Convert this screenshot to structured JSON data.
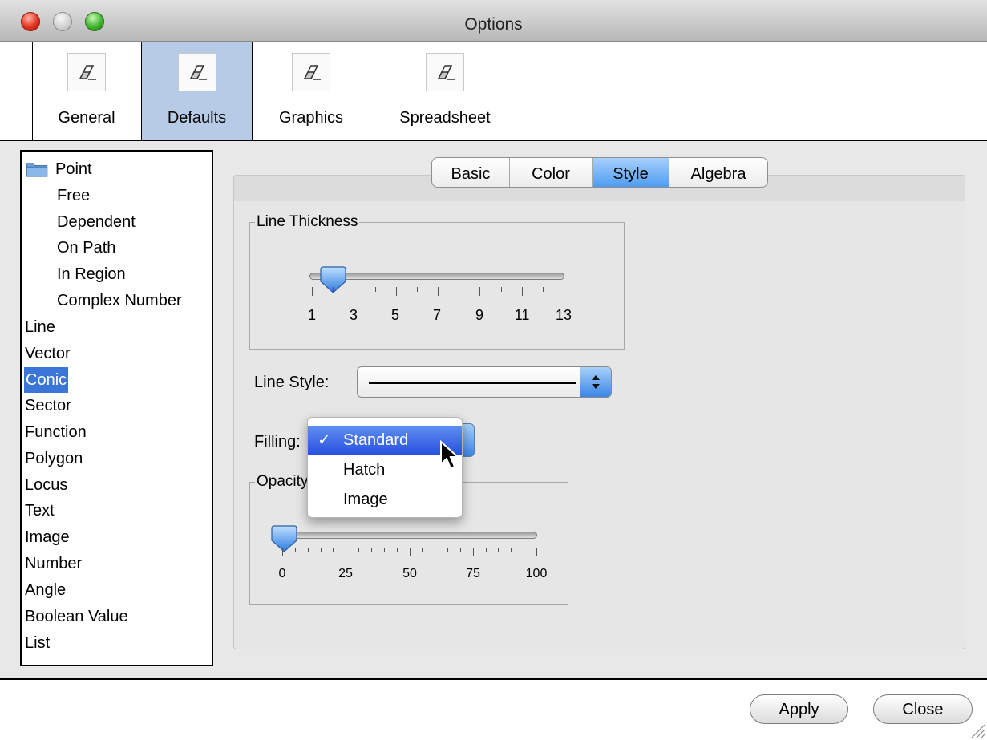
{
  "window": {
    "title": "Options"
  },
  "toolbar": {
    "buttons": [
      {
        "label": "General",
        "icon": "eraser-icon",
        "selected": false
      },
      {
        "label": "Defaults",
        "icon": "eraser-icon",
        "selected": true
      },
      {
        "label": "Graphics",
        "icon": "eraser-icon",
        "selected": false
      },
      {
        "label": "Spreadsheet",
        "icon": "eraser-icon",
        "selected": false
      }
    ]
  },
  "tree": {
    "items": [
      {
        "label": "Point",
        "icon": "folder-icon"
      },
      {
        "label": "Free"
      },
      {
        "label": "Dependent"
      },
      {
        "label": "On Path"
      },
      {
        "label": "In Region"
      },
      {
        "label": "Complex Number"
      },
      {
        "label": "Line"
      },
      {
        "label": "Vector"
      },
      {
        "label": "Conic",
        "selected": true
      },
      {
        "label": "Sector"
      },
      {
        "label": "Function"
      },
      {
        "label": "Polygon"
      },
      {
        "label": "Locus"
      },
      {
        "label": "Text"
      },
      {
        "label": "Image"
      },
      {
        "label": "Number"
      },
      {
        "label": "Angle"
      },
      {
        "label": "Boolean Value"
      },
      {
        "label": "List"
      }
    ]
  },
  "tabs": [
    {
      "label": "Basic"
    },
    {
      "label": "Color"
    },
    {
      "label": "Style",
      "active": true
    },
    {
      "label": "Algebra"
    }
  ],
  "line_thickness": {
    "label": "Line Thickness",
    "value": 2,
    "min": 1,
    "max": 13,
    "tick_labels": [
      "1",
      "3",
      "5",
      "7",
      "9",
      "11",
      "13"
    ]
  },
  "line_style": {
    "label": "Line Style:",
    "selected": "solid-line"
  },
  "filling": {
    "label": "Filling:",
    "options": [
      {
        "label": "Standard",
        "checked": true,
        "highlighted": true
      },
      {
        "label": "Hatch"
      },
      {
        "label": "Image"
      }
    ],
    "check_mark": "✓"
  },
  "opacity": {
    "label": "Opacity",
    "value": 0,
    "min": 0,
    "max": 100,
    "tick_labels": [
      "0",
      "25",
      "50",
      "75",
      "100"
    ]
  },
  "buttons": {
    "apply": "Apply",
    "close": "Close"
  },
  "colors": {
    "selection": "#3b75d7",
    "toolbar_selected": "#b7cbe6",
    "tab_active": "#4f9cf2"
  }
}
